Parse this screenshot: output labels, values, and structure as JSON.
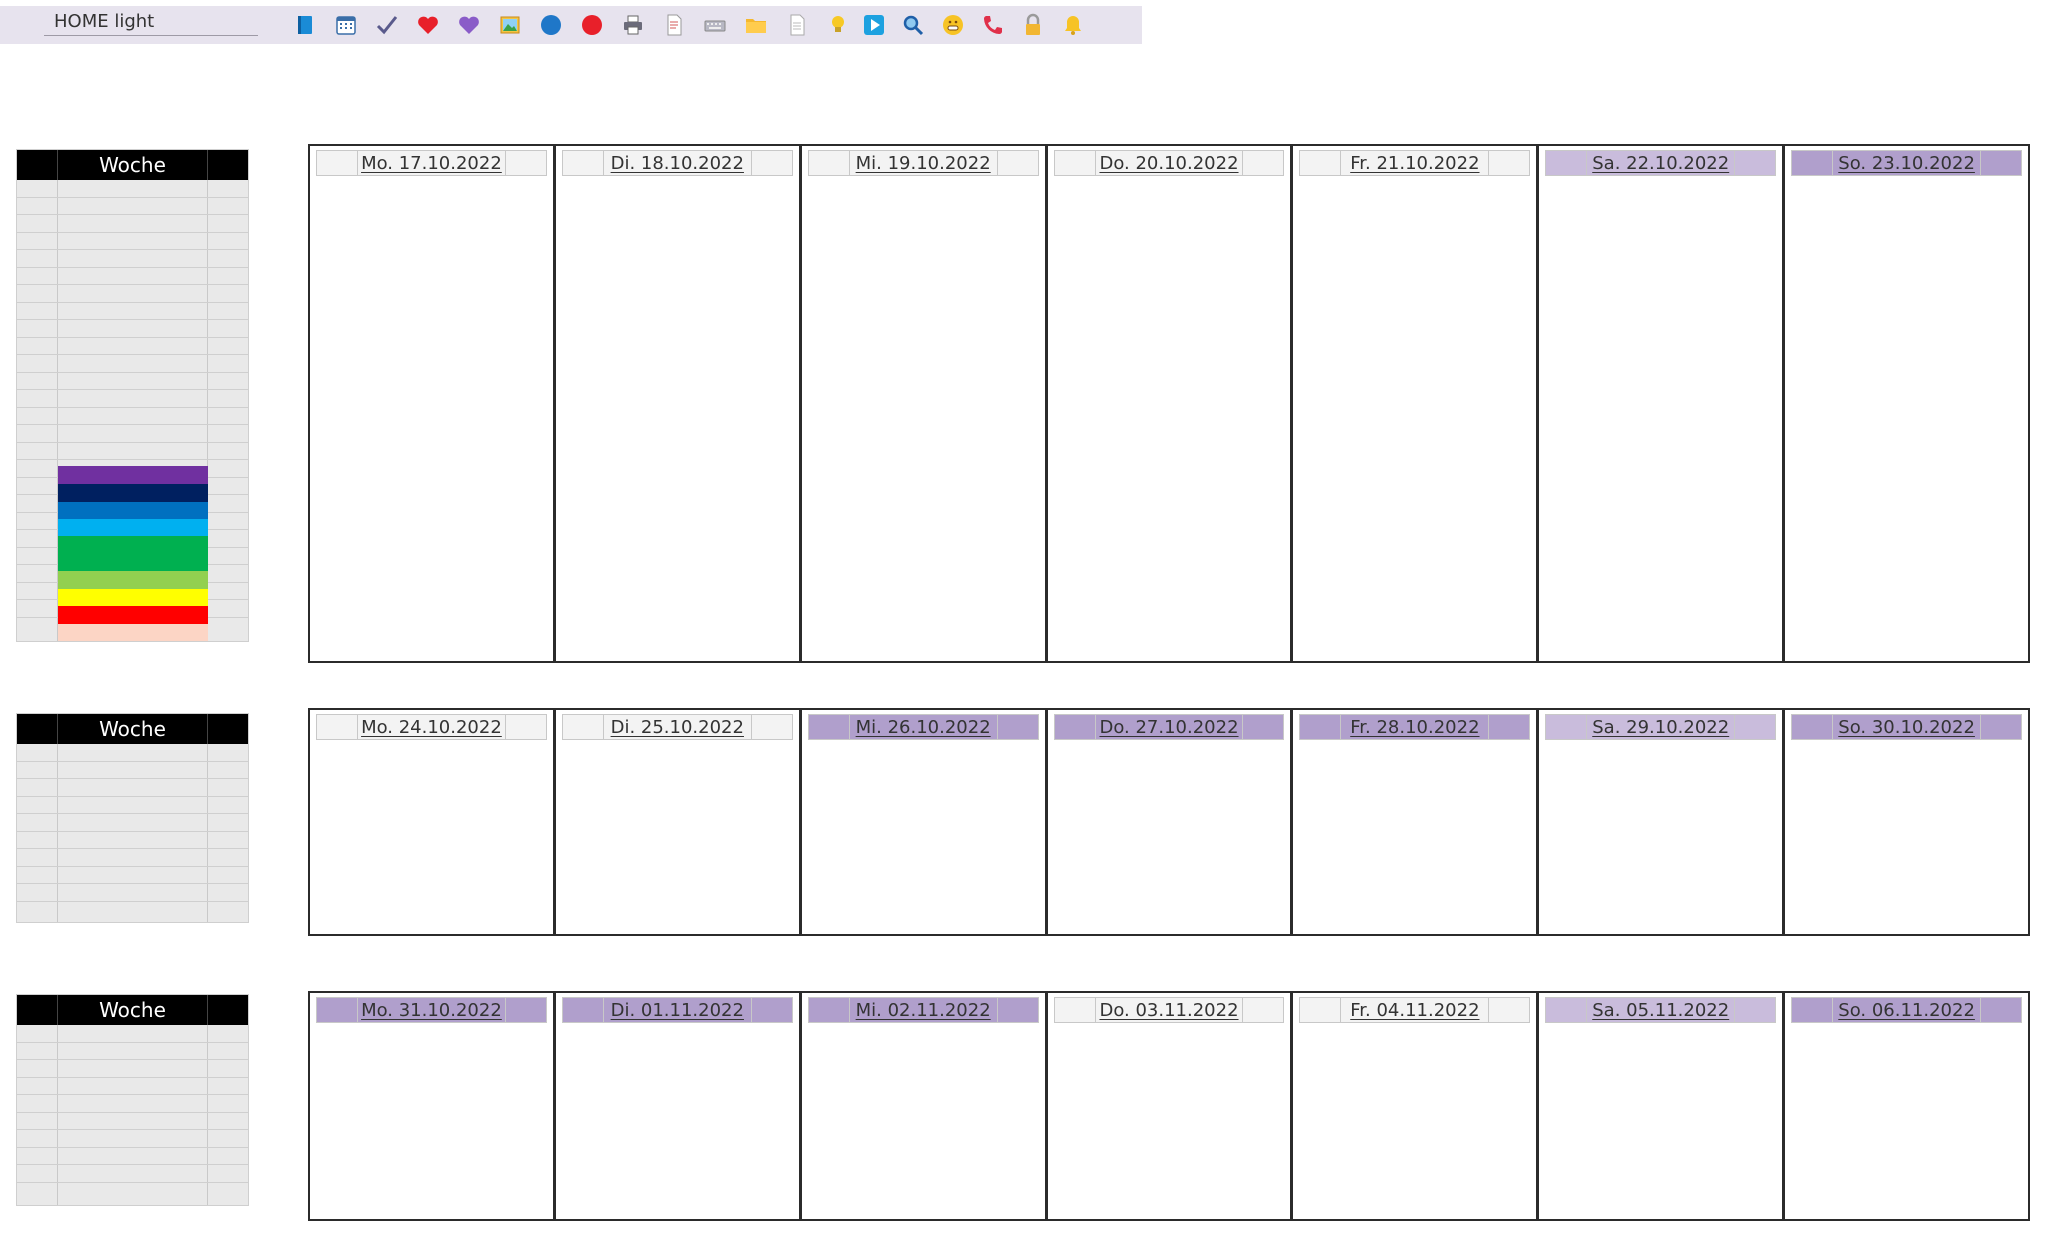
{
  "toolbar": {
    "title": "HOME light",
    "icons": [
      "book-icon",
      "calendar-icon",
      "checkmark-icon",
      "red-heart-icon",
      "purple-heart-icon",
      "picture-icon",
      "blue-circle-icon",
      "red-circle-icon",
      "printer-icon",
      "document-icon",
      "keyboard-icon",
      "folder-icon",
      "page-icon",
      "lightbulb-icon",
      "play-button-icon",
      "magnifier-icon",
      "grinning-face-icon",
      "telephone-icon",
      "lock-icon",
      "bell-icon"
    ]
  },
  "week_label": "Woche",
  "palette": [
    "#7030a0",
    "#002060",
    "#0070c0",
    "#00b0f0",
    "#00b050",
    "#92d050",
    "#ffff00",
    "#ff0000",
    "#fcd5c5"
  ],
  "weeks": [
    {
      "days": [
        {
          "label": "Mo. 17.10.2022",
          "highlight": "none"
        },
        {
          "label": "Di. 18.10.2022",
          "highlight": "none"
        },
        {
          "label": "Mi. 19.10.2022",
          "highlight": "none"
        },
        {
          "label": "Do. 20.10.2022",
          "highlight": "none"
        },
        {
          "label": "Fr. 21.10.2022",
          "highlight": "none"
        },
        {
          "label": "Sa. 22.10.2022",
          "highlight": "light"
        },
        {
          "label": "So. 23.10.2022",
          "highlight": "dark"
        }
      ]
    },
    {
      "days": [
        {
          "label": "Mo. 24.10.2022",
          "highlight": "none"
        },
        {
          "label": "Di. 25.10.2022",
          "highlight": "none"
        },
        {
          "label": "Mi. 26.10.2022",
          "highlight": "dark"
        },
        {
          "label": "Do. 27.10.2022",
          "highlight": "dark"
        },
        {
          "label": "Fr. 28.10.2022",
          "highlight": "dark"
        },
        {
          "label": "Sa. 29.10.2022",
          "highlight": "light"
        },
        {
          "label": "So. 30.10.2022",
          "highlight": "dark"
        }
      ]
    },
    {
      "days": [
        {
          "label": "Mo. 31.10.2022",
          "highlight": "dark"
        },
        {
          "label": "Di. 01.11.2022",
          "highlight": "dark"
        },
        {
          "label": "Mi. 02.11.2022",
          "highlight": "dark"
        },
        {
          "label": "Do. 03.11.2022",
          "highlight": "none"
        },
        {
          "label": "Fr. 04.11.2022",
          "highlight": "none"
        },
        {
          "label": "Sa. 05.11.2022",
          "highlight": "light"
        },
        {
          "label": "So. 06.11.2022",
          "highlight": "dark"
        }
      ]
    }
  ]
}
